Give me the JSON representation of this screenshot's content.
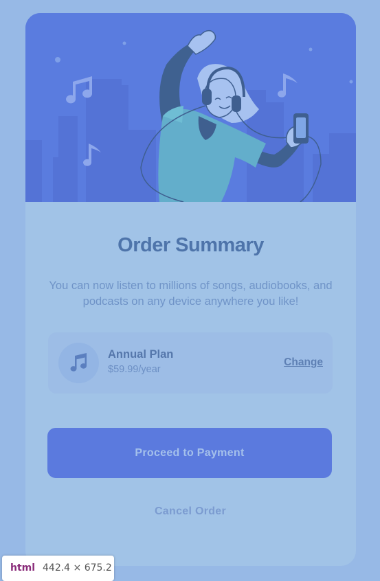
{
  "order": {
    "title": "Order Summary",
    "description": "You can now listen to millions of songs, audiobooks, and podcasts on any device anywhere you like!",
    "plan": {
      "icon": "music-note-icon",
      "name": "Annual Plan",
      "price": "$59.99/year",
      "change_label": "Change"
    },
    "proceed_label": "Proceed to Payment",
    "cancel_label": "Cancel Order"
  },
  "devtools_tooltip": {
    "tag": "html",
    "size": "442.4 × 675.2"
  },
  "colors": {
    "page_background": "#97b9e6",
    "card_background": "#a1c3e7",
    "hero_background": "#5a7cdf",
    "accent": "#5b7ade",
    "title": "#4e74aa"
  }
}
